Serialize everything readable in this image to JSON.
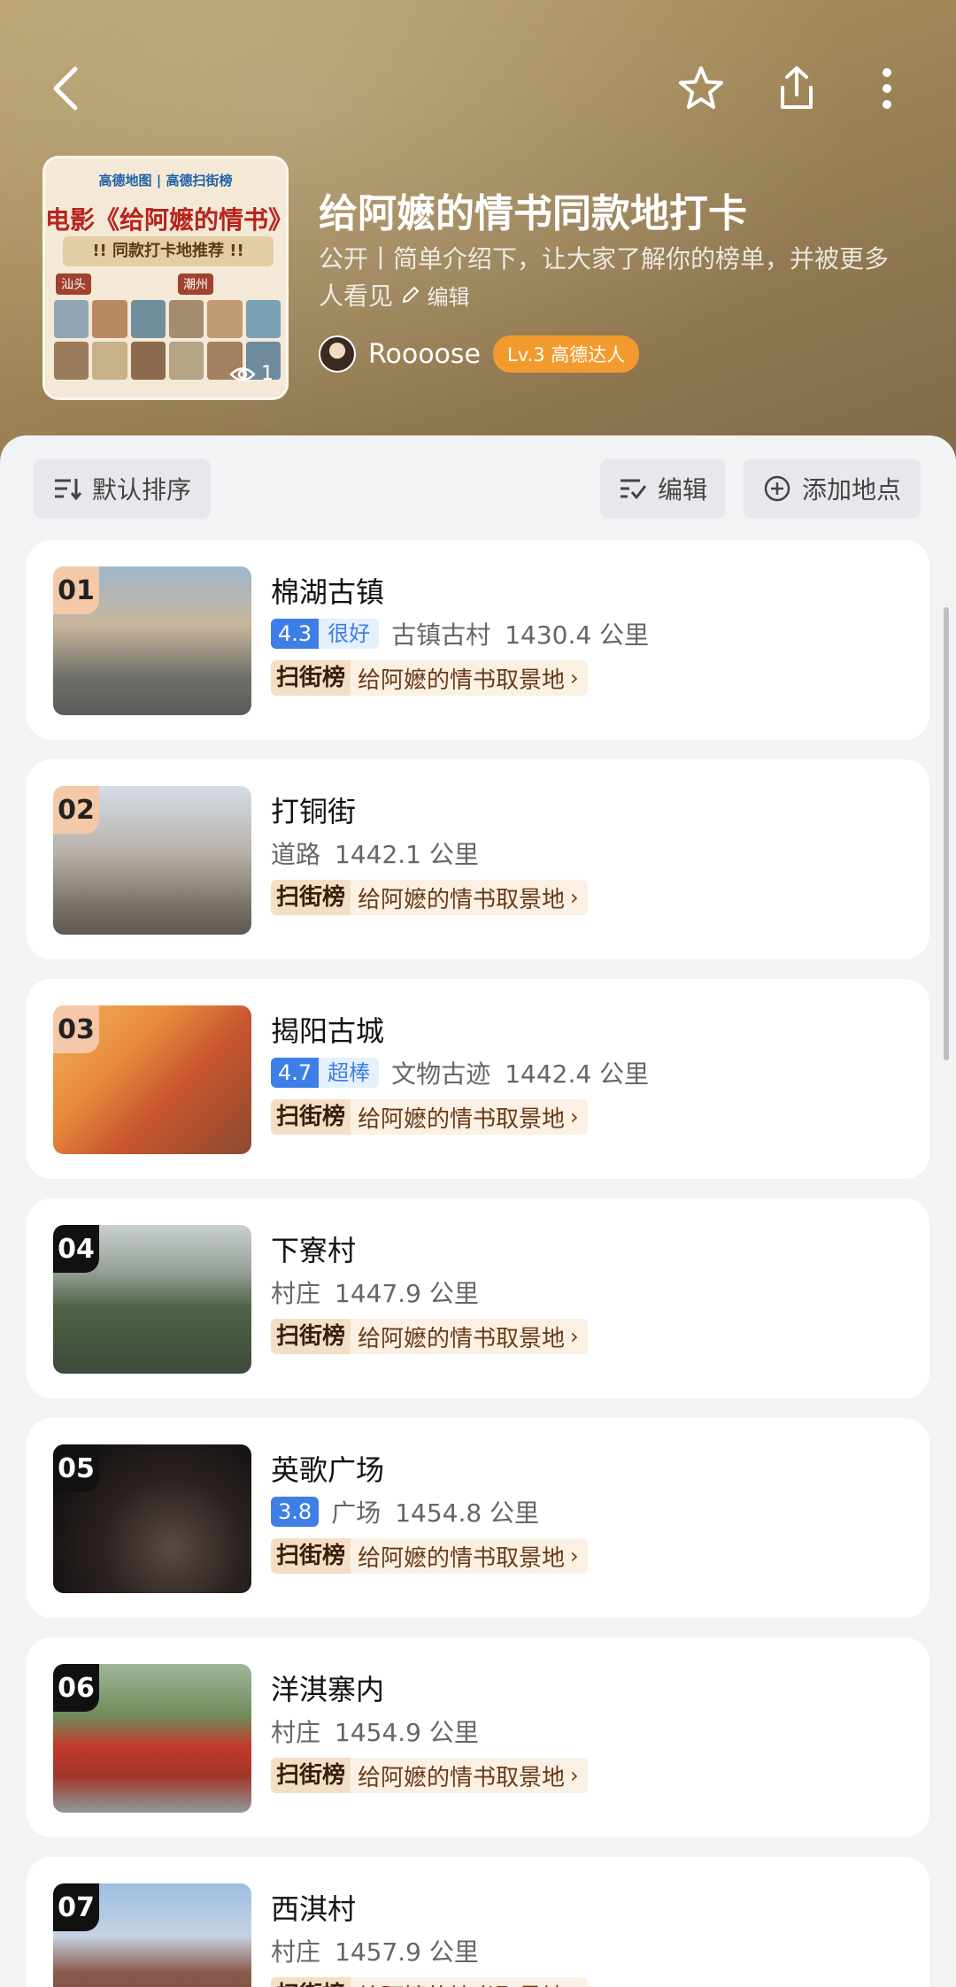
{
  "header": {
    "title": "给阿嬷的情书同款地打卡",
    "description": "公开丨简单介绍下，让大家了解你的榜单，并被更多人看见",
    "edit_label": "编辑",
    "views": "1",
    "author_name": "Roooose",
    "author_level": "Lv.3 高德达人"
  },
  "cover": {
    "logos": "高德地图 | 高德扫街榜",
    "movie": "电影《给阿嬷的情书》",
    "subtitle": "!! 同款打卡地推荐 !!",
    "tag_left": "汕头",
    "tag_right": "潮州"
  },
  "toolbar": {
    "sort_label": "默认排序",
    "edit_label": "编辑",
    "add_label": "添加地点"
  },
  "badge_brand": "扫街榜",
  "places": [
    {
      "rank": "01",
      "name": "棉湖古镇",
      "score": "4.3",
      "score_word": "很好",
      "category": "古镇古村",
      "distance": "1430.4 公里",
      "badge": "给阿嬷的情书取景地"
    },
    {
      "rank": "02",
      "name": "打铜街",
      "score": "",
      "score_word": "",
      "category": "道路",
      "distance": "1442.1 公里",
      "badge": "给阿嬷的情书取景地"
    },
    {
      "rank": "03",
      "name": "揭阳古城",
      "score": "4.7",
      "score_word": "超棒",
      "category": "文物古迹",
      "distance": "1442.4 公里",
      "badge": "给阿嬷的情书取景地"
    },
    {
      "rank": "04",
      "name": "下寮村",
      "score": "",
      "score_word": "",
      "category": "村庄",
      "distance": "1447.9 公里",
      "badge": "给阿嬷的情书取景地"
    },
    {
      "rank": "05",
      "name": "英歌广场",
      "score": "3.8",
      "score_word": "",
      "category": "广场",
      "distance": "1454.8 公里",
      "badge": "给阿嬷的情书取景地"
    },
    {
      "rank": "06",
      "name": "洋淇寨内",
      "score": "",
      "score_word": "",
      "category": "村庄",
      "distance": "1454.9 公里",
      "badge": "给阿嬷的情书取景地"
    },
    {
      "rank": "07",
      "name": "西淇村",
      "score": "",
      "score_word": "",
      "category": "村庄",
      "distance": "1457.9 公里",
      "badge": "给阿嬷的情书取景地"
    }
  ]
}
